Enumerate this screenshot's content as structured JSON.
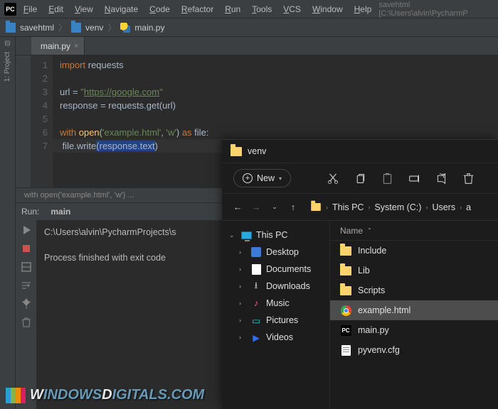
{
  "ide": {
    "logo": "PC",
    "menu": [
      "File",
      "Edit",
      "View",
      "Navigate",
      "Code",
      "Refactor",
      "Run",
      "Tools",
      "VCS",
      "Window",
      "Help"
    ],
    "project_hint": "savehtml [C:\\Users\\alvin\\PycharmP",
    "crumbs": [
      "savehtml",
      "venv",
      "main.py"
    ],
    "left_tab": "1: Project",
    "tab": {
      "label": "main.py",
      "close": "×"
    },
    "line_numbers": [
      "1",
      "2",
      "3",
      "4",
      "5",
      "6",
      "7"
    ],
    "code": {
      "l1": {
        "kw": "import",
        "rest": " requests"
      },
      "l3a": "url = ",
      "l3s": "\"",
      "l3link": "https://google.com",
      "l3e": "\"",
      "l4": "response = requests.get(url)",
      "l5a": "with ",
      "l5fn": "open",
      "l5b": "(",
      "l5s1": "'example.html'",
      "l5c": ", ",
      "l5s2": "'w'",
      "l5d": ") ",
      "l5kw": "as",
      "l5e": " file:",
      "l6a": " file.write",
      "l6b": "(response.text",
      "l6c": ")"
    },
    "inline_crumb": "with open('example.html', 'w') ...",
    "run": {
      "title_prefix": "Run:",
      "config": "main",
      "out1": "C:\\Users\\alvin\\PycharmProjects\\s",
      "out2": "Process finished with exit code "
    }
  },
  "explorer": {
    "title": "venv",
    "new_label": "New",
    "path": [
      "This PC",
      "System (C:)",
      "Users",
      "a"
    ],
    "tree_root": "This PC",
    "tree_items": [
      "Desktop",
      "Documents",
      "Downloads",
      "Music",
      "Pictures",
      "Videos"
    ],
    "list_header": "Name",
    "items": [
      {
        "name": "Include",
        "type": "folder"
      },
      {
        "name": "Lib",
        "type": "folder"
      },
      {
        "name": "Scripts",
        "type": "folder"
      },
      {
        "name": "example.html",
        "type": "chrome",
        "selected": true
      },
      {
        "name": "main.py",
        "type": "pycharm"
      },
      {
        "name": "pyvenv.cfg",
        "type": "cfg"
      }
    ]
  },
  "watermark": {
    "a": "W",
    "b": "INDOWS",
    "c": "D",
    "d": "IGITALS.COM"
  }
}
